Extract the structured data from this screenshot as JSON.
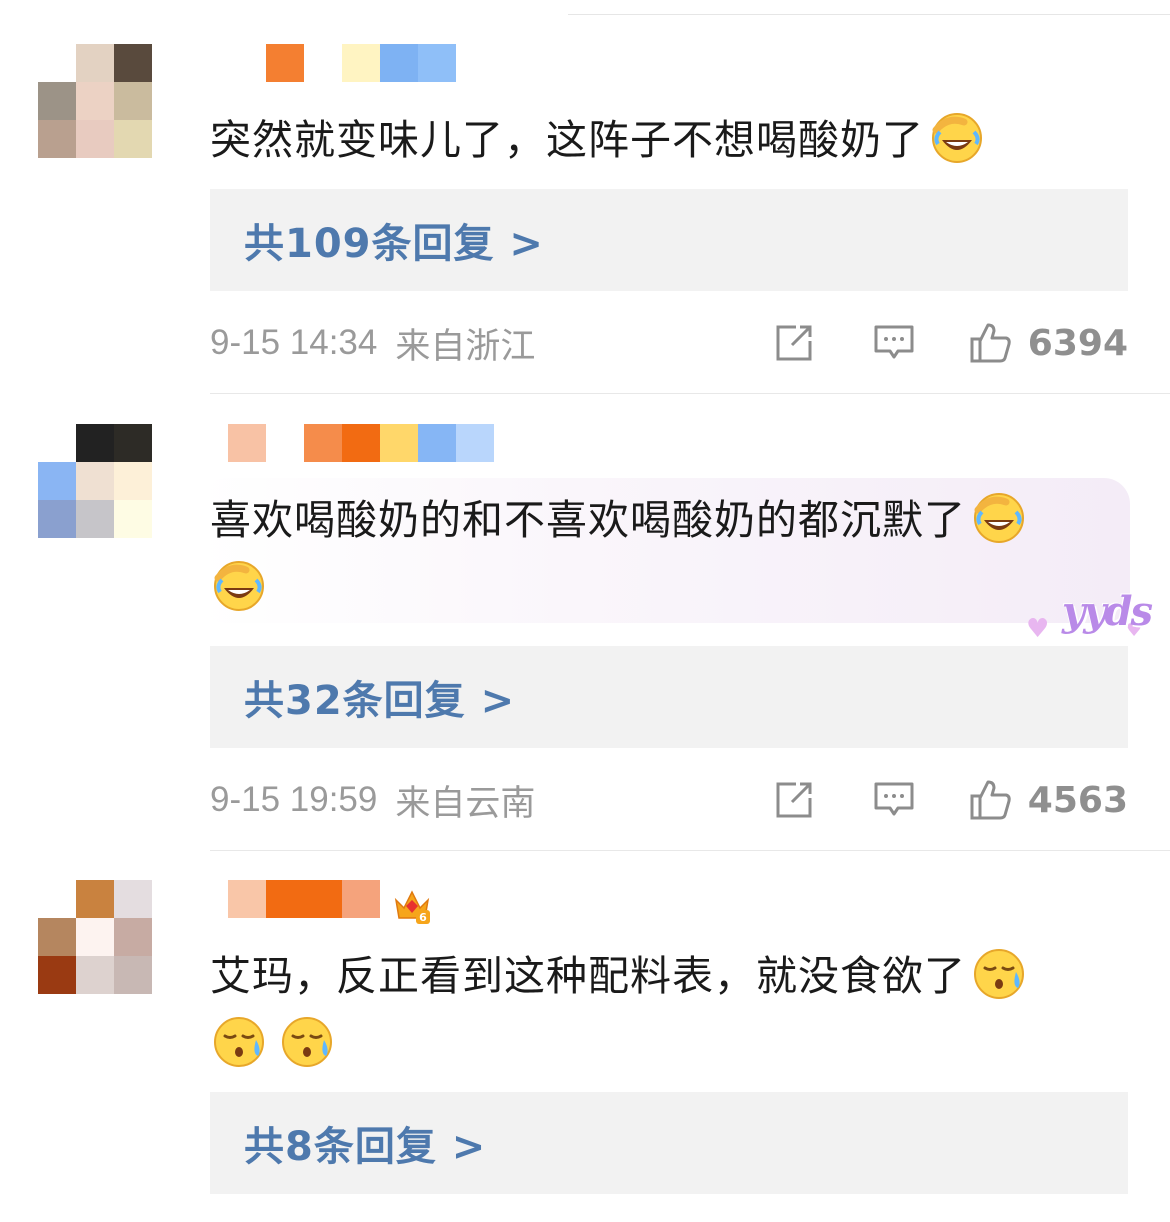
{
  "comments": [
    {
      "text": "突然就变味儿了，这阵子不想喝酸奶了",
      "replies": "共109条回复 >",
      "time": "9-15 14:34",
      "location": "来自浙江",
      "likes": "6394",
      "emojis": [
        "laugh-cry-emoji"
      ],
      "colors": {
        "avatar": [
          "#ffffff",
          "#e3d2c2",
          "#594a3d",
          "#9c9387",
          "#ecd2c4",
          "#cabb9e",
          "#b9a08f",
          "#e8cbc0",
          "#e3d8b1"
        ],
        "username": [
          "#ffffff",
          "#f47f31",
          "#ffffff",
          "#fff4c2",
          "#7eb2f3",
          "#8fbff8"
        ]
      }
    },
    {
      "text": "喜欢喝酸奶的和不喜欢喝酸奶的都沉默了",
      "replies": "共32条回复 >",
      "time": "9-15 19:59",
      "location": "来自云南",
      "likes": "4563",
      "badge": "yyds",
      "emojis": [
        "laugh-cry-emoji",
        "laugh-cry-emoji"
      ],
      "colors": {
        "avatar": [
          "#ffffff",
          "#222222",
          "#2d2b26",
          "#8ab5f3",
          "#efe0d2",
          "#fdf0d8",
          "#8aa0cf",
          "#c6c5c9",
          "#fefce4"
        ],
        "username": [
          "#f8c2a5",
          "#ffffff",
          "#f58c4b",
          "#f26b12",
          "#ffd76a",
          "#86b6f5",
          "#b9d6fc"
        ]
      }
    },
    {
      "text": "艾玛，反正看到这种配料表，就没食欲了",
      "replies": "共8条回复 >",
      "emojis": [
        "sweat-emoji",
        "sweat-emoji",
        "sweat-emoji"
      ],
      "crown_level": "6",
      "colors": {
        "avatar": [
          "#ffffff",
          "#c9823f",
          "#e4dde0",
          "#b5865f",
          "#fdf3f0",
          "#c7aba3",
          "#9a3a12",
          "#ddd2cf",
          "#c8b8b4"
        ],
        "username": [
          "#f9c6a8",
          "#f26b12",
          "#f26b12",
          "#f5a37c"
        ]
      }
    }
  ]
}
